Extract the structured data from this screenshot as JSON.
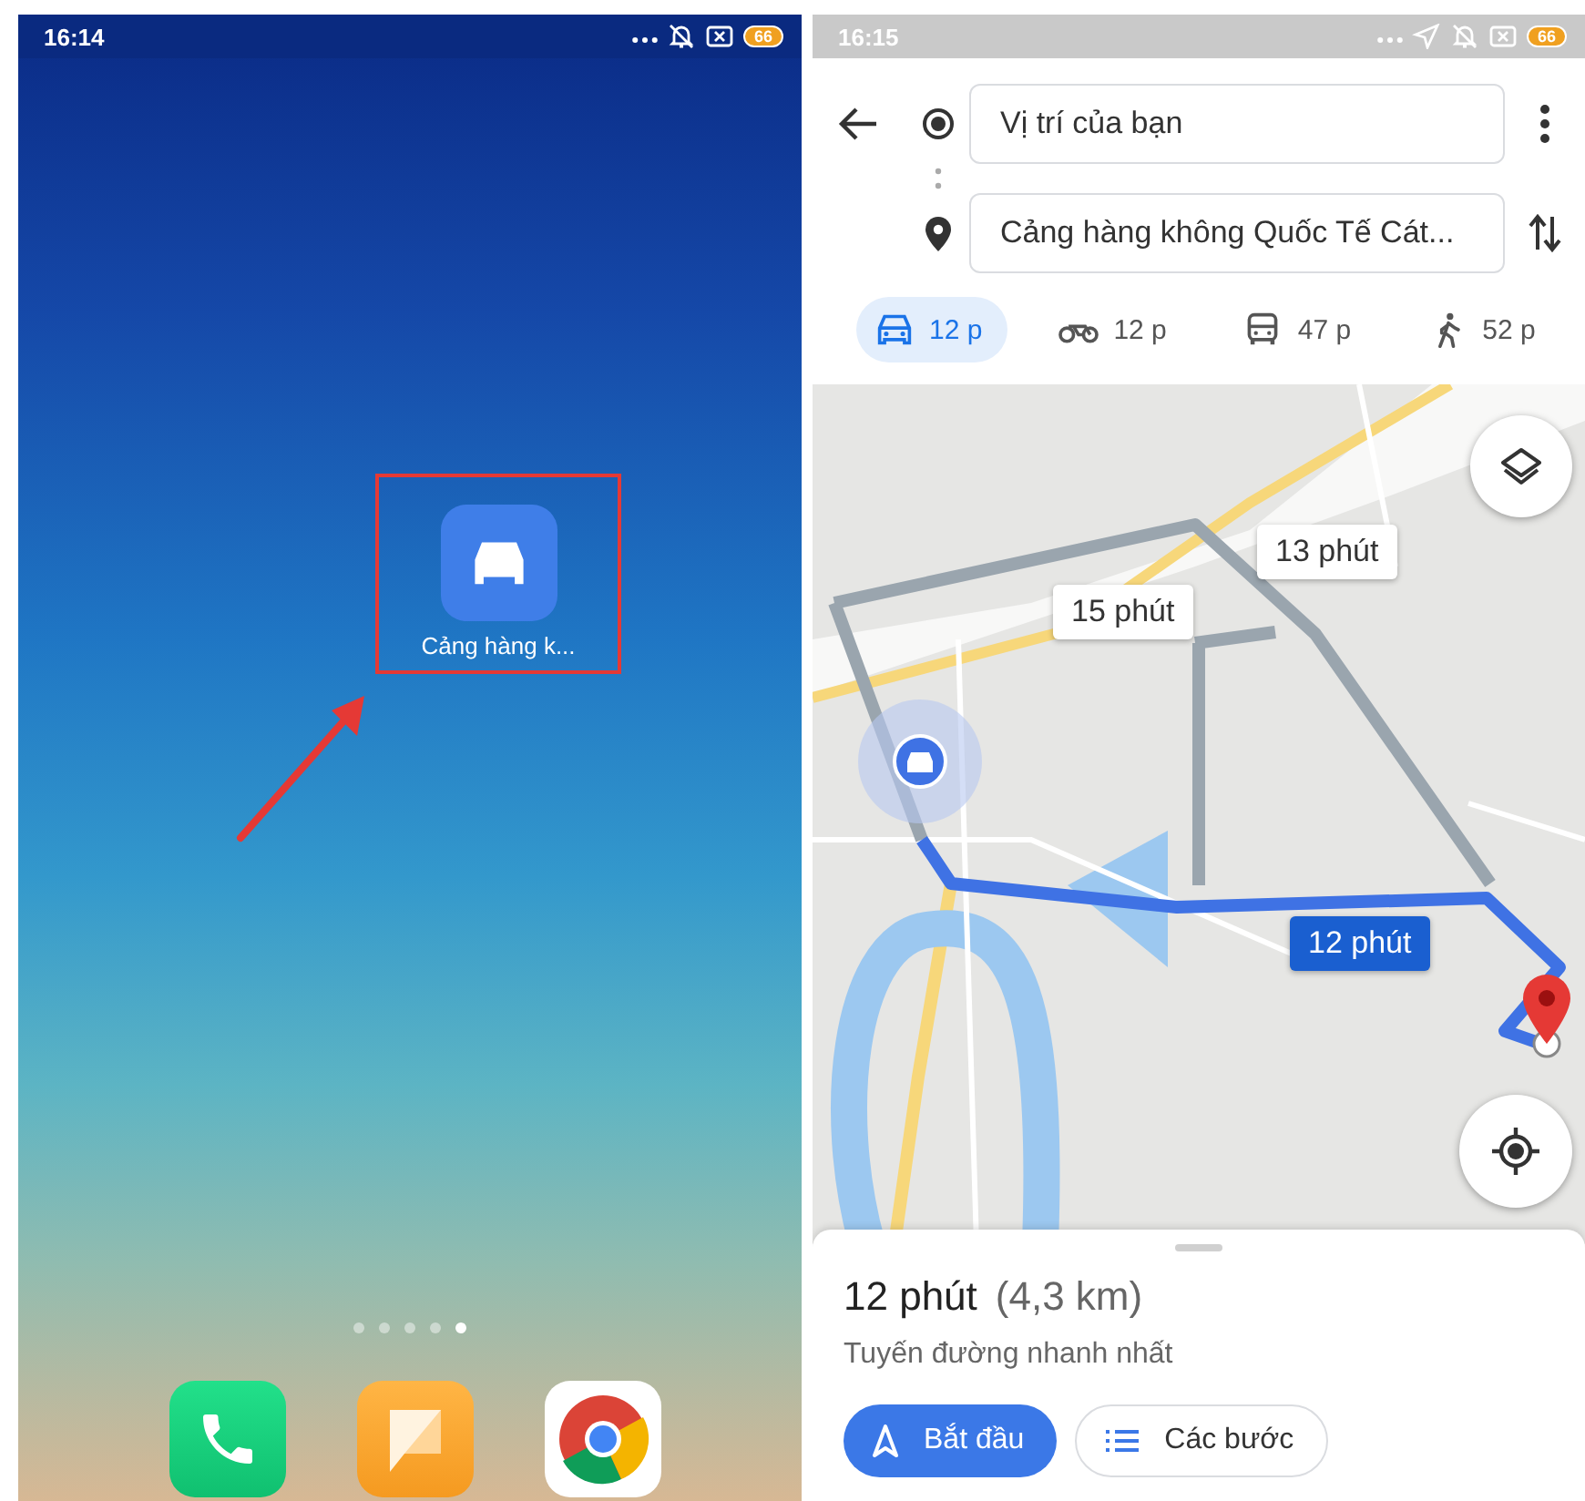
{
  "home_screen": {
    "status_bar": {
      "time": "16:14",
      "icons": [
        {
          "kind": "more"
        },
        {
          "kind": "bell-off"
        },
        {
          "kind": "sim-x"
        }
      ],
      "battery": "66"
    },
    "shortcut": {
      "label": "Cảng hàng k...",
      "highlighted": true
    },
    "page_dots": [
      {
        "selected": false
      },
      {
        "selected": false
      },
      {
        "selected": false
      },
      {
        "selected": false
      },
      {
        "selected": true
      }
    ],
    "dock": [
      {
        "kind": "phone"
      },
      {
        "kind": "messages"
      },
      {
        "kind": "browser"
      }
    ]
  },
  "maps_screen": {
    "status_bar": {
      "time": "16:15",
      "icons": [
        {
          "kind": "more"
        },
        {
          "kind": "location"
        },
        {
          "kind": "bell-off"
        },
        {
          "kind": "sim-x"
        }
      ],
      "battery": "66"
    },
    "origin": {
      "value": "Vị trí của bạn"
    },
    "destination": {
      "value": "Cảng hàng không Quốc Tế Cát..."
    },
    "modes": [
      {
        "kind": "car",
        "label": "12 p",
        "selected": true
      },
      {
        "kind": "motorbike",
        "label": "12 p",
        "selected": false
      },
      {
        "kind": "bus",
        "label": "47 p",
        "selected": false
      },
      {
        "kind": "walk",
        "label": "52 p",
        "selected": false
      }
    ],
    "map": {
      "kind": "picture",
      "route_labels": [
        {
          "text": "13 phút",
          "selected": false
        },
        {
          "text": "15 phút",
          "selected": false
        },
        {
          "text": "12 phút",
          "selected": true
        }
      ]
    },
    "summary": {
      "duration": "12 phút",
      "distance": "(4,3 km)",
      "note": "Tuyến đường nhanh nhất"
    },
    "buttons": [
      {
        "kind": "primary",
        "label": "Bắt đầu"
      },
      {
        "kind": "secondary",
        "label": "Các bước"
      }
    ]
  }
}
